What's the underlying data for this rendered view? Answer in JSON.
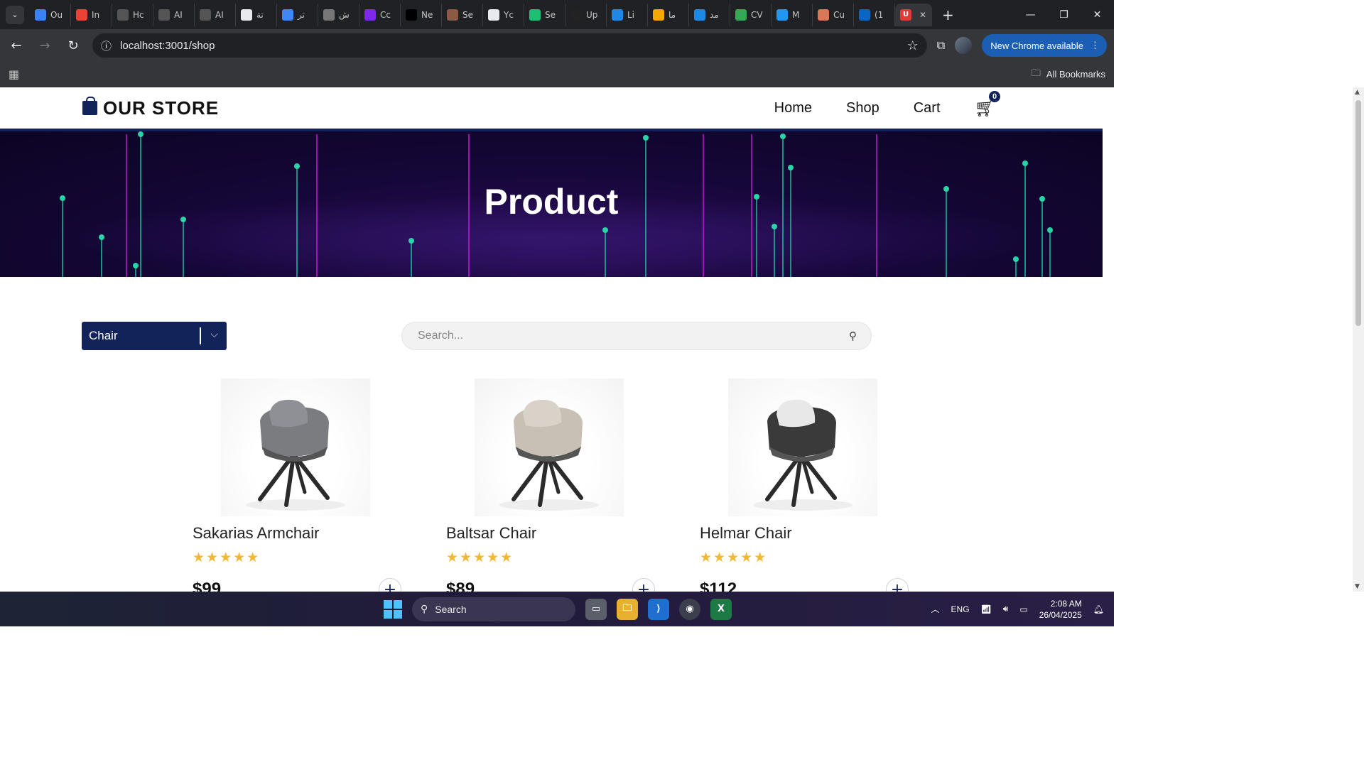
{
  "browser": {
    "tabs": [
      {
        "label": "Ou",
        "icon": "copilot-icon",
        "color": "#3b82f6"
      },
      {
        "label": "In",
        "icon": "gmail-icon",
        "color": "#ea4335"
      },
      {
        "label": "Hc",
        "icon": "ai-icon",
        "color": "#555555"
      },
      {
        "label": "AI",
        "icon": "ai-icon",
        "color": "#555555"
      },
      {
        "label": "AI",
        "icon": "ai-icon",
        "color": "#555555"
      },
      {
        "label": "تة",
        "icon": "openai-icon",
        "color": "#e8eaed"
      },
      {
        "label": "تر",
        "icon": "translate-icon",
        "color": "#4285f4"
      },
      {
        "label": "ش",
        "icon": "loading-icon",
        "color": "#777777"
      },
      {
        "label": "Cc",
        "icon": "canva-icon",
        "color": "#7d2ae8"
      },
      {
        "label": "Ne",
        "icon": "next-icon",
        "color": "#000000"
      },
      {
        "label": "Se",
        "icon": "profile-icon",
        "color": "#8a5a44"
      },
      {
        "label": "Yc",
        "icon": "github-icon",
        "color": "#e8eaed"
      },
      {
        "label": "Se",
        "icon": "fiverr-icon",
        "color": "#1dbf73"
      },
      {
        "label": "Up",
        "icon": "upwork-icon",
        "color": "#222222"
      },
      {
        "label": "Li",
        "icon": "video-icon",
        "color": "#1e88e5"
      },
      {
        "label": "ما",
        "icon": "five-icon",
        "color": "#f6a800"
      },
      {
        "label": "مد",
        "icon": "circle-icon",
        "color": "#1e88e5"
      },
      {
        "label": "CV",
        "icon": "drive-icon",
        "color": "#34a853"
      },
      {
        "label": "M",
        "icon": "m-icon",
        "color": "#2196f3"
      },
      {
        "label": "Cu",
        "icon": "claude-icon",
        "color": "#d97757"
      },
      {
        "label": "(1",
        "icon": "linkedin-icon",
        "color": "#0a66c2"
      }
    ],
    "active_tab_icon_color": "#e53935",
    "address": "localhost:3001/shop",
    "update_button": "New Chrome available",
    "all_bookmarks": "All Bookmarks"
  },
  "site": {
    "logo": "OUR STORE",
    "nav": [
      "Home",
      "Shop",
      "Cart"
    ],
    "cart_count": "0",
    "hero_title": "Product"
  },
  "filters": {
    "category_selected": "Chair",
    "search_placeholder": "Search..."
  },
  "products": [
    {
      "name": "Sakarias Armchair",
      "price": "$99",
      "rating": 5,
      "seat_color": "#7a7c80",
      "back_color": "#8e9095"
    },
    {
      "name": "Baltsar Chair",
      "price": "$89",
      "rating": 5,
      "seat_color": "#c8c0b4",
      "back_color": "#d8d2c8"
    },
    {
      "name": "Helmar Chair",
      "price": "$112",
      "rating": 5,
      "seat_color": "#3a3a3a",
      "back_color": "#e8e8e8"
    }
  ],
  "taskbar": {
    "search_label": "Search",
    "language": "ENG",
    "time": "2:08 AM",
    "date": "26/04/2025"
  },
  "colors": {
    "brand": "#12235a",
    "star": "#f5b731"
  }
}
